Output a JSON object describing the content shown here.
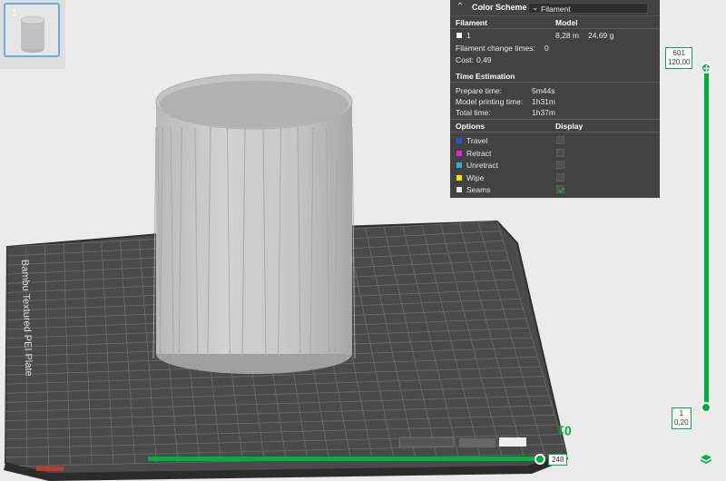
{
  "thumbnail": {
    "index": "1"
  },
  "panel": {
    "header": {
      "title": "Color Scheme",
      "selected": "Filament"
    },
    "filament_col": "Filament",
    "model_col": "Model",
    "filament_row": {
      "id": "1",
      "length": "8,28 m",
      "weight": "24,69 g",
      "color": "#ffffff"
    },
    "change_times_label": "Filament change times:",
    "change_times_value": "0",
    "cost_label": "Cost:",
    "cost_value": "0,49",
    "time_section": "Time Estimation",
    "times": [
      {
        "label": "Prepare time:",
        "value": "5m44s"
      },
      {
        "label": "Model printing time:",
        "value": "1h31m"
      },
      {
        "label": "Total time:",
        "value": "1h37m"
      }
    ],
    "options_col": "Options",
    "display_col": "Display",
    "options": [
      {
        "label": "Travel",
        "color": "#3b4bd8",
        "checked": false
      },
      {
        "label": "Retract",
        "color": "#d12bd1",
        "checked": false
      },
      {
        "label": "Unretract",
        "color": "#35a8e0",
        "checked": false
      },
      {
        "label": "Wipe",
        "color": "#f2e600",
        "checked": false
      },
      {
        "label": "Seams",
        "color": "#e8e8e8",
        "checked": true
      }
    ]
  },
  "vertical_slider": {
    "top_layer": "601",
    "top_height": "120,00",
    "bottom_layer": "1",
    "bottom_height": "0,20"
  },
  "horizontal_slider": {
    "value": "248"
  },
  "plate": {
    "label": "Bambu Textured PEI Plate",
    "number": "01"
  },
  "colors": {
    "accent": "#00ae42",
    "panel_bg": "#3a3a3a"
  }
}
